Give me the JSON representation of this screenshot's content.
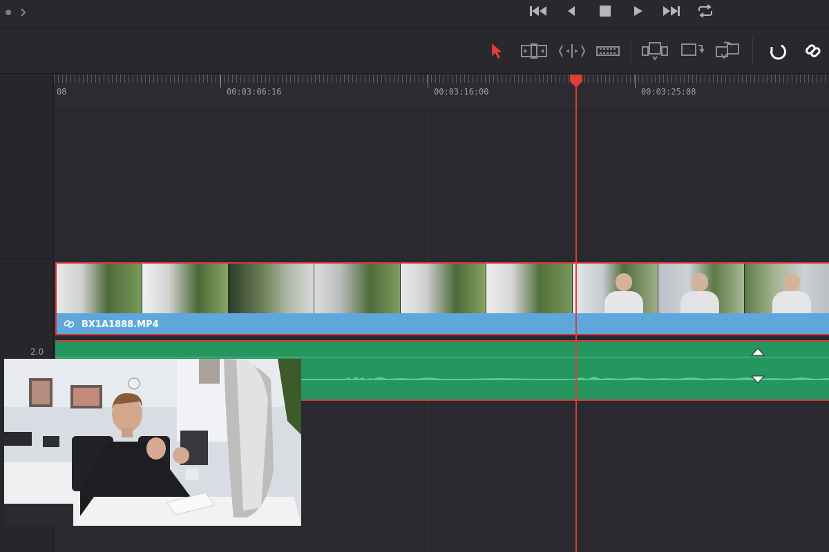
{
  "transport": {
    "icons": [
      "skip-to-start-icon",
      "previous-frame-icon",
      "stop-icon",
      "play-icon",
      "skip-to-end-icon",
      "loop-icon"
    ]
  },
  "toolbar": {
    "icons": [
      "selection-tool-icon",
      "trim-edit-icon",
      "dynamic-trim-icon",
      "blade-tool-icon",
      "insert-clip-icon",
      "overwrite-clip-icon",
      "replace-clip-icon",
      "snapping-icon",
      "linked-selection-icon"
    ],
    "accent": "#e23b3b"
  },
  "ruler": {
    "labels": [
      "08",
      "00:03:06:16",
      "00:03:16:00",
      "00:03:25:08"
    ]
  },
  "tracks": {
    "video": {
      "clip_name": "BX1A1888.MP4",
      "color": "#5ea7dc"
    },
    "audio": {
      "level": "2.0",
      "color": "#25965f"
    }
  },
  "colors": {
    "playhead": "#e23b3b",
    "background": "#27272c"
  }
}
